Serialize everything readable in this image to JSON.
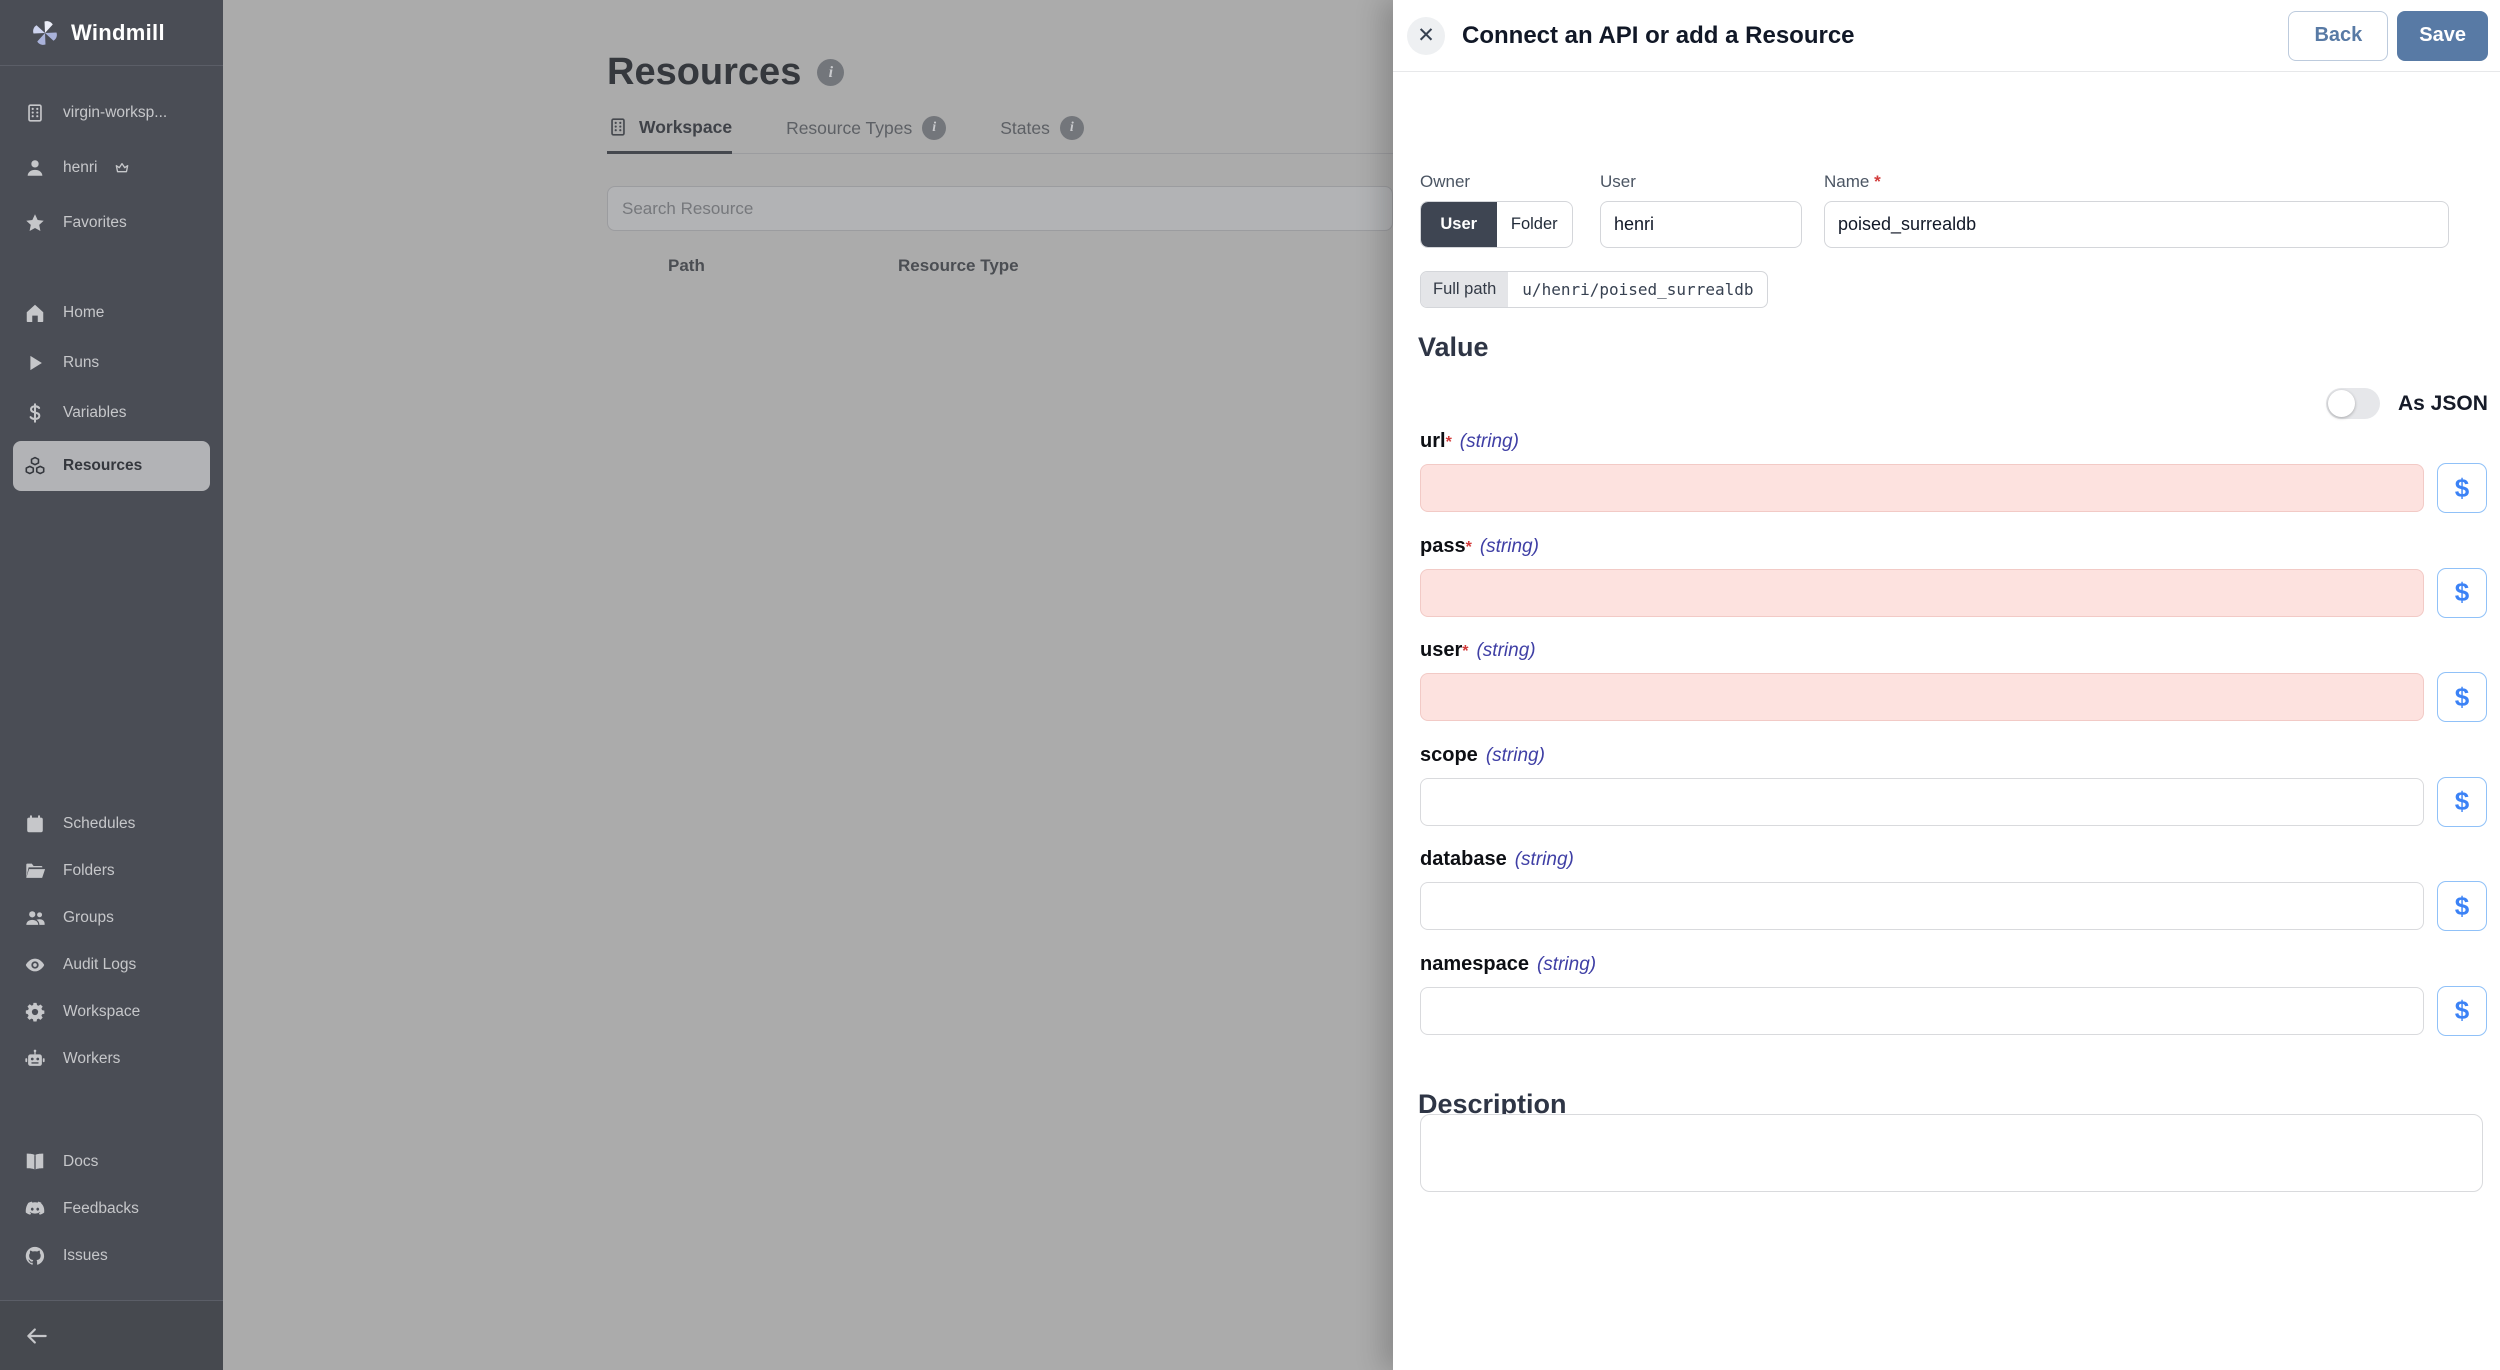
{
  "colors": {
    "accent": "#587aa5",
    "dollar": "#3b82f6",
    "required_bg": "#fde2df",
    "sidebar_bg": "#4a4d55",
    "main_bg": "#ababab",
    "selected_pill": "#b2b3b6"
  },
  "sidebar": {
    "brand": "Windmill",
    "top": [
      {
        "label": "virgin-worksp...",
        "icon": "building"
      },
      {
        "label": "henri",
        "icon": "user",
        "badge_icon": "crown"
      },
      {
        "label": "Favorites",
        "icon": "star"
      }
    ],
    "nav": [
      {
        "label": "Home",
        "icon": "home"
      },
      {
        "label": "Runs",
        "icon": "play"
      },
      {
        "label": "Variables",
        "icon": "dollar"
      },
      {
        "label": "Resources",
        "icon": "boxes",
        "active": true
      }
    ],
    "admin": [
      {
        "label": "Schedules",
        "icon": "calendar"
      },
      {
        "label": "Folders",
        "icon": "folder"
      },
      {
        "label": "Groups",
        "icon": "users"
      },
      {
        "label": "Audit Logs",
        "icon": "eye"
      },
      {
        "label": "Workspace",
        "icon": "gear"
      },
      {
        "label": "Workers",
        "icon": "robot"
      }
    ],
    "links": [
      {
        "label": "Docs",
        "icon": "book"
      },
      {
        "label": "Feedbacks",
        "icon": "discord"
      },
      {
        "label": "Issues",
        "icon": "github"
      }
    ]
  },
  "main": {
    "title": "Resources",
    "tabs": [
      {
        "label": "Workspace",
        "active": true
      },
      {
        "label": "Resource Types",
        "info": true
      },
      {
        "label": "States",
        "info": true
      }
    ],
    "search_placeholder": "Search Resource",
    "columns": [
      "Path",
      "Resource Type"
    ]
  },
  "drawer": {
    "title": "Connect an API or add a Resource",
    "back_label": "Back",
    "save_label": "Save",
    "owner_label": "Owner",
    "owner_options": [
      "User",
      "Folder"
    ],
    "owner_selected": "User",
    "user_label": "User",
    "user_value": "henri",
    "name_label": "Name",
    "name_required_mark": "*",
    "name_value": "poised_surrealdb",
    "full_path_label": "Full path",
    "full_path_value": "u/henri/poised_surrealdb",
    "value_heading": "Value",
    "as_json_label": "As JSON",
    "as_json_on": false,
    "dollar_label": "$",
    "fields": [
      {
        "name": "url",
        "required": true,
        "type": "(string)",
        "value": ""
      },
      {
        "name": "pass",
        "required": true,
        "type": "(string)",
        "value": ""
      },
      {
        "name": "user",
        "required": true,
        "type": "(string)",
        "value": ""
      },
      {
        "name": "scope",
        "required": false,
        "type": "(string)",
        "value": ""
      },
      {
        "name": "database",
        "required": false,
        "type": "(string)",
        "value": ""
      },
      {
        "name": "namespace",
        "required": false,
        "type": "(string)",
        "value": ""
      }
    ],
    "description_heading": "Description",
    "description_value": ""
  }
}
